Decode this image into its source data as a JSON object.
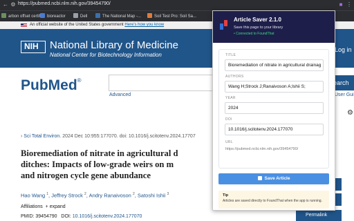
{
  "browser": {
    "url": "https://pubmed.ncbi.nlm.nih.gov/39454790/",
    "bookmarks": [
      {
        "label": "arbon offset certifi...",
        "color": "#6b8f5e"
      },
      {
        "label": "bioreactor",
        "color": "#4a7bd0"
      },
      {
        "label": "Dell",
        "color": "#9aa0a6"
      },
      {
        "label": "The National Map -...",
        "color": "#3a6fb0"
      },
      {
        "label": "Soil Test Pro: Soil Sa...",
        "color": "#e07b39"
      }
    ]
  },
  "gov_banner": {
    "text": "An official website of the United States government",
    "link": "Here's how you know"
  },
  "header": {
    "logo_text": "NIH",
    "title": "National Library of Medicine",
    "subtitle": "National Center for Biotechnology Information",
    "login": "Log in"
  },
  "search": {
    "logo": "PubMed",
    "logo_mark": "®",
    "advanced": "Advanced",
    "button": "earch",
    "user_guide": "User Gui"
  },
  "article": {
    "journal": "Sci Total Environ.",
    "citation": "2024 Dec 10:955:177070. doi: 10.1016/j.scitotenv.2024.17707",
    "title_lines": [
      "Bioremediation of nitrate in agricultural d",
      "ditches: Impacts of low-grade weirs on m",
      "and nitrogen cycle gene abundance"
    ],
    "authors": [
      {
        "name": "Hao Wang",
        "sup": "1"
      },
      {
        "name": "Jeffrey Strock",
        "sup": "2"
      },
      {
        "name": "Andry Ranaivoson",
        "sup": "2"
      },
      {
        "name": "Satoshi Ishii",
        "sup": "3"
      }
    ],
    "affiliations": "Affiliations",
    "expand": "+ expand",
    "pmid": "PMID: 39454790",
    "doi_label": "DOI:",
    "doi": "10.1016/j.scitotenv.2024.177070",
    "permalink": "Permalink"
  },
  "extension": {
    "title": "Article Saver 2.1.0",
    "subtitle": "Save this page to your library",
    "status": "• Connected to FoundThat",
    "fields": {
      "title_label": "TITLE",
      "title_value": "Bioremediation of nitrate in agricultural drainag",
      "authors_label": "AUTHORS",
      "authors_value": "Wang H;Strock J;Ranaivoson A;Ishii S;",
      "year_label": "YEAR",
      "year_value": "2024",
      "doi_label": "DOI",
      "doi_value": "10.1016/j.scitotenv.2024.177070",
      "url_label": "URL",
      "url_value": "https://pubmed.ncbi.nlm.nih.gov/39454790/"
    },
    "save_button": "Save Article",
    "tip_title": "Tip",
    "tip_text": "Articles are saved directly to FoundThat when the app is running."
  }
}
